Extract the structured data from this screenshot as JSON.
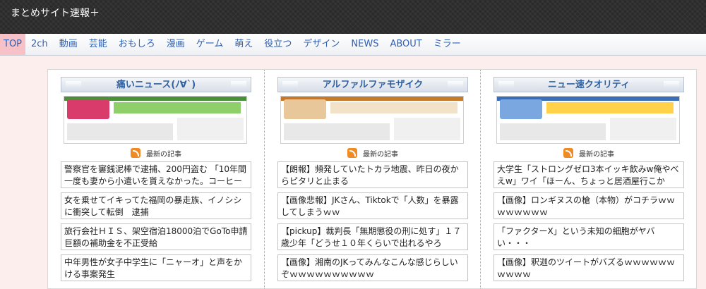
{
  "site": {
    "title": "まとめサイト速報＋"
  },
  "nav": [
    "TOP",
    "2ch",
    "動画",
    "芸能",
    "おもしろ",
    "漫画",
    "ゲーム",
    "萌え",
    "役立つ",
    "デザイン",
    "NEWS",
    "ABOUT",
    "ミラー"
  ],
  "latest_label": "最新の記事",
  "columns": [
    {
      "title": "痛いニュース(ﾉ∀`)",
      "thumb_colors": {
        "bar": "#4a8f3a",
        "logo": "#d93c6a",
        "accent": "#8fcf6a"
      },
      "items": [
        "警察官を窶銭泥棒で逮捕、200円盗む 「10年間一度も妻から小遣いを貰えなかった。コーヒー",
        "女を乗せてイキってた福岡の暴走族、イノシシに衝突して転倒　逮捕",
        "旅行会社ＨＩＳ、架空宿泊18000泊でGoTo申請巨額の補助金を不正受給",
        "中年男性が女子中学生に「ニャーオ」と声をかける事案発生"
      ]
    },
    {
      "title": "アルファルファモザイク",
      "thumb_colors": {
        "bar": "#c47a2a",
        "logo": "#e8c79a",
        "accent": "#f2e3c8"
      },
      "items": [
        "【朗報】頻発していたトカラ地震、昨日の夜からピタリと止まる",
        "【画像悲報】JKさん、Tiktokで「人数」を暴露してしまうｗｗ",
        "【pickup】裁判長「無期懲役の刑に処す」１７歳少年「どうせ１０年くらいで出れるやろ",
        "【画像】湘南のJKってみんなこんな感じらしいぞｗｗｗｗｗｗｗｗｗｗ"
      ]
    },
    {
      "title": "ニュー速クオリティ",
      "thumb_colors": {
        "bar": "#3a6fb8",
        "logo": "#7aa7e0",
        "accent": "#ffd24a"
      },
      "items": [
        "大学生「ストロングゼロ3本イッキ飲みw俺やべえw」ワイ「ほーん、ちょっと居酒屋行こか",
        "【画像】ロンギヌスの槍（本物）がコチラｗｗｗｗｗｗｗｗ",
        "「ファクターX」という未知の細胞がヤバい・・・",
        "【画像】釈迦のツイートがバズるｗｗｗｗｗｗｗｗｗｗ"
      ]
    }
  ]
}
